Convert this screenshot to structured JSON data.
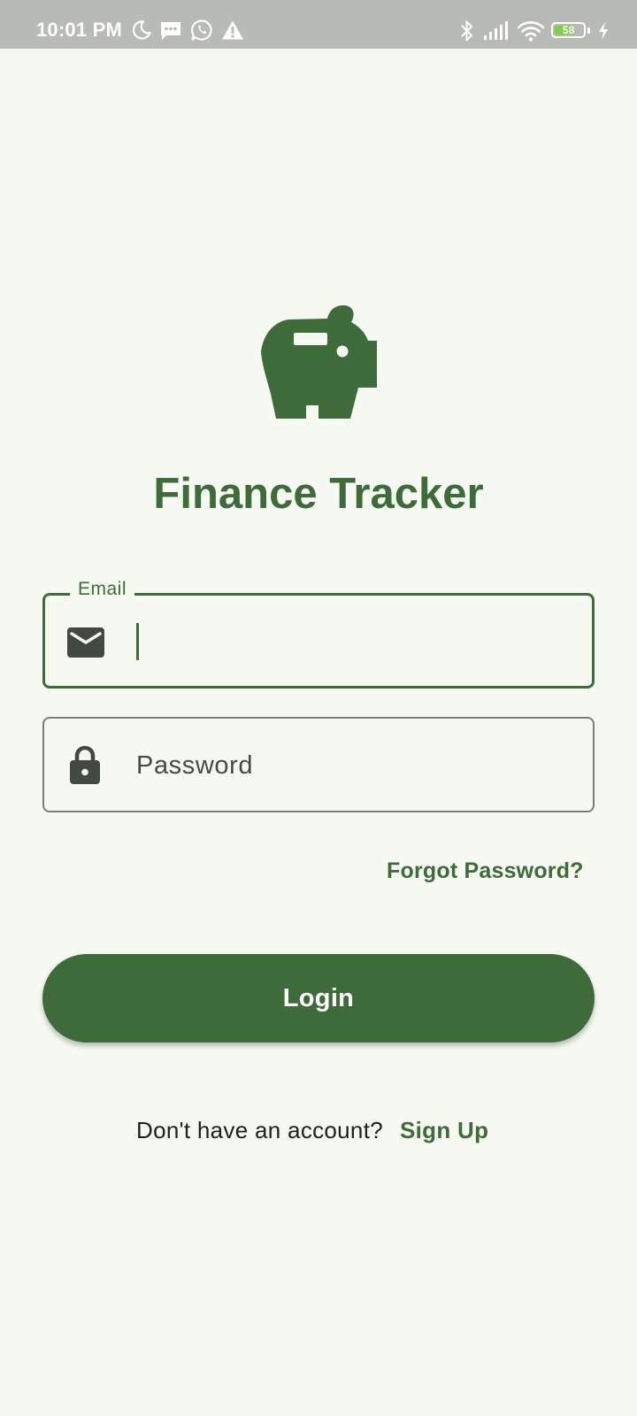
{
  "status_bar": {
    "time": "10:01 PM",
    "battery_level": "58",
    "battery_fill_color": "#7bd13f",
    "icons": [
      "moon-icon",
      "message-icon",
      "whatsapp-icon",
      "warning-icon",
      "bluetooth-icon",
      "signal-icon",
      "wifi-icon",
      "battery-icon",
      "charging-icon"
    ]
  },
  "app": {
    "logo_icon": "piggy-bank-icon",
    "title": "Finance Tracker"
  },
  "email": {
    "label": "Email",
    "value": "",
    "icon": "mail-icon"
  },
  "password": {
    "placeholder": "Password",
    "value": "",
    "icon": "lock-icon"
  },
  "forgot_password": "Forgot Password?",
  "login_button": "Login",
  "signup": {
    "prompt": "Don't have an account?",
    "link": "Sign Up"
  },
  "colors": {
    "primary": "#3e6b3a",
    "background": "#f6f9f1",
    "status_bar": "#b8bab5",
    "icon_dark": "#424940",
    "outline": "#7b7f78"
  }
}
